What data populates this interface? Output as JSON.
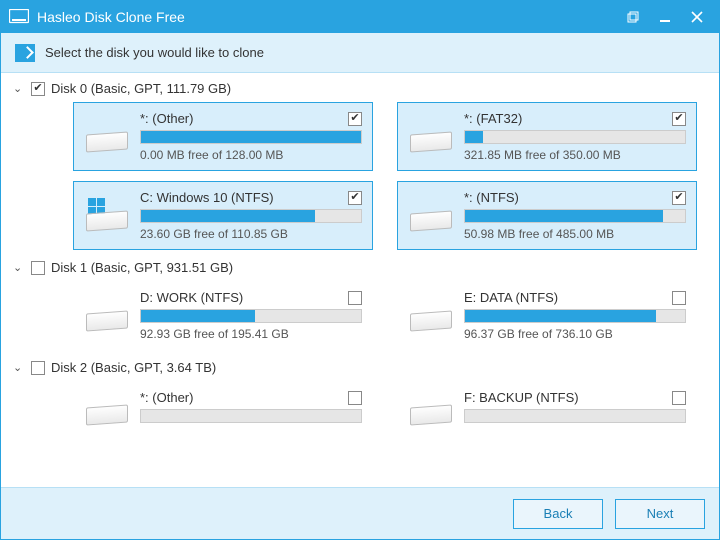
{
  "app": {
    "title": "Hasleo Disk Clone Free"
  },
  "instruction": "Select the disk you would like to clone",
  "footer": {
    "back_label": "Back",
    "next_label": "Next"
  },
  "disks": [
    {
      "label": "Disk 0 (Basic, GPT, 111.79 GB)",
      "checked": true,
      "expanded": true,
      "partitions": [
        {
          "name": "*: (Other)",
          "free_text": "0.00 MB free of 128.00 MB",
          "checked": true,
          "selected": true,
          "fill_pct": 100,
          "win_icon": false
        },
        {
          "name": "*: (FAT32)",
          "free_text": "321.85 MB free of 350.00 MB",
          "checked": true,
          "selected": true,
          "fill_pct": 8,
          "win_icon": false
        },
        {
          "name": "C: Windows 10 (NTFS)",
          "free_text": "23.60 GB free of 110.85 GB",
          "checked": true,
          "selected": true,
          "fill_pct": 79,
          "win_icon": true
        },
        {
          "name": "*: (NTFS)",
          "free_text": "50.98 MB free of 485.00 MB",
          "checked": true,
          "selected": true,
          "fill_pct": 90,
          "win_icon": false
        }
      ]
    },
    {
      "label": "Disk 1 (Basic, GPT, 931.51 GB)",
      "checked": false,
      "expanded": true,
      "partitions": [
        {
          "name": "D: WORK (NTFS)",
          "free_text": "92.93 GB free of 195.41 GB",
          "checked": false,
          "selected": false,
          "fill_pct": 52,
          "win_icon": false
        },
        {
          "name": "E: DATA (NTFS)",
          "free_text": "96.37 GB free of 736.10 GB",
          "checked": false,
          "selected": false,
          "fill_pct": 87,
          "win_icon": false
        }
      ]
    },
    {
      "label": "Disk 2 (Basic, GPT, 3.64 TB)",
      "checked": false,
      "expanded": true,
      "partitions": [
        {
          "name": "*: (Other)",
          "free_text": "",
          "checked": false,
          "selected": false,
          "fill_pct": 0,
          "win_icon": false
        },
        {
          "name": "F: BACKUP (NTFS)",
          "free_text": "",
          "checked": false,
          "selected": false,
          "fill_pct": 0,
          "win_icon": false
        }
      ]
    }
  ]
}
